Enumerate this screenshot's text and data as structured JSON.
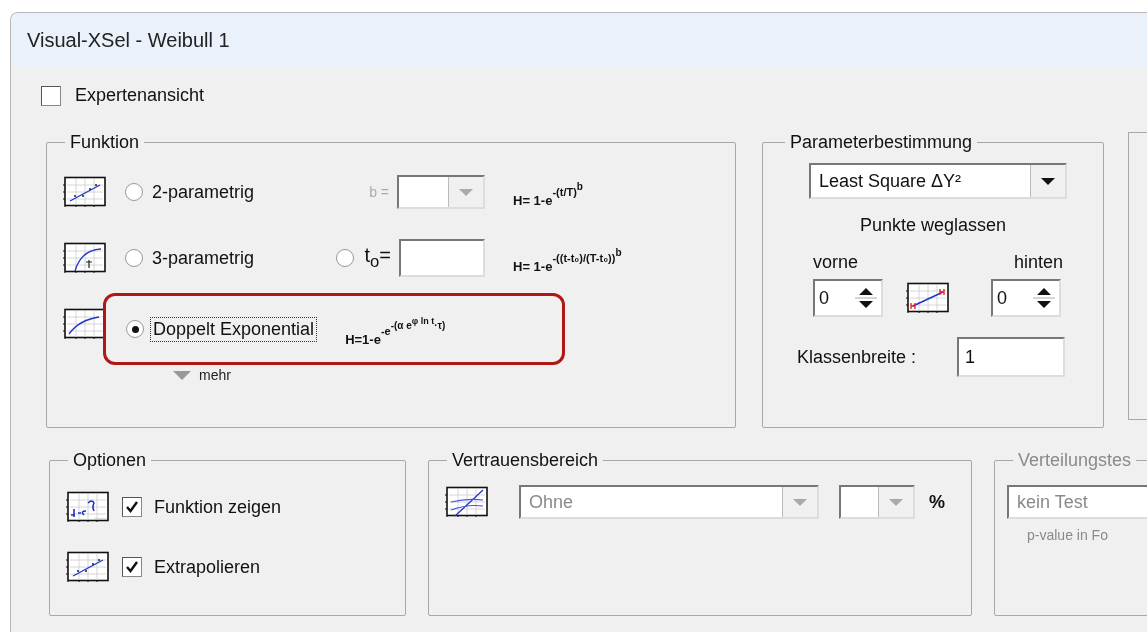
{
  "window": {
    "title": "Visual-XSel - Weibull 1"
  },
  "expert_view": {
    "label": "Expertenansicht",
    "checked": false
  },
  "function_group": {
    "title": "Funktion",
    "rows": [
      {
        "kind": "two_param",
        "label": "2-parametrig",
        "selected": false,
        "param": {
          "label": "b =",
          "disabled": true
        },
        "formula": [
          {
            "text": "H= 1-e",
            "kind": "base"
          },
          {
            "text": "-(t/T)",
            "kind": "sup"
          },
          {
            "text": "b",
            "kind": "supsup"
          }
        ]
      },
      {
        "kind": "three_param",
        "label": "3-parametrig",
        "selected": false,
        "param": {
          "label": "t$_{o}$=",
          "selected": false
        },
        "formula": [
          {
            "text": "H= 1-e",
            "kind": "base"
          },
          {
            "text": "-((t-t₀)/(T-t₀))",
            "kind": "sup"
          },
          {
            "text": "b",
            "kind": "supsup"
          }
        ]
      },
      {
        "kind": "double_exp",
        "label": "Doppelt Exponential",
        "selected": true,
        "focused": true,
        "highlighted": true,
        "formula": [
          {
            "text": "H=1-e",
            "kind": "base"
          },
          {
            "text": "-e",
            "kind": "sup"
          },
          {
            "text": "-(α e",
            "kind": "supsup"
          },
          {
            "text": "φ ln t",
            "kind": "sup3"
          },
          {
            "text": "·τ)",
            "kind": "supsup"
          }
        ]
      }
    ],
    "more": "mehr"
  },
  "parameter_group": {
    "title": "Parameterbestimmung",
    "method": "Least Square ΔY²",
    "omit_label": "Punkte weglassen",
    "front": {
      "label": "vorne",
      "value": "0"
    },
    "back": {
      "label": "hinten",
      "value": "0"
    },
    "class_width": {
      "label": "Klassenbreite :",
      "value": "1"
    }
  },
  "options_group": {
    "title": "Optionen",
    "items": [
      {
        "kind": "function",
        "label": "Funktion zeigen",
        "checked": true
      },
      {
        "kind": "extrapolate",
        "label": "Extrapolieren",
        "checked": true
      }
    ]
  },
  "confidence_group": {
    "title": "Vertrauensbereich",
    "range": "Ohne",
    "unit": "%",
    "disabled": true
  },
  "test_group": {
    "title": "Verteilungstes",
    "test": "kein Test",
    "note": "p-value in Fo",
    "disabled": true
  }
}
